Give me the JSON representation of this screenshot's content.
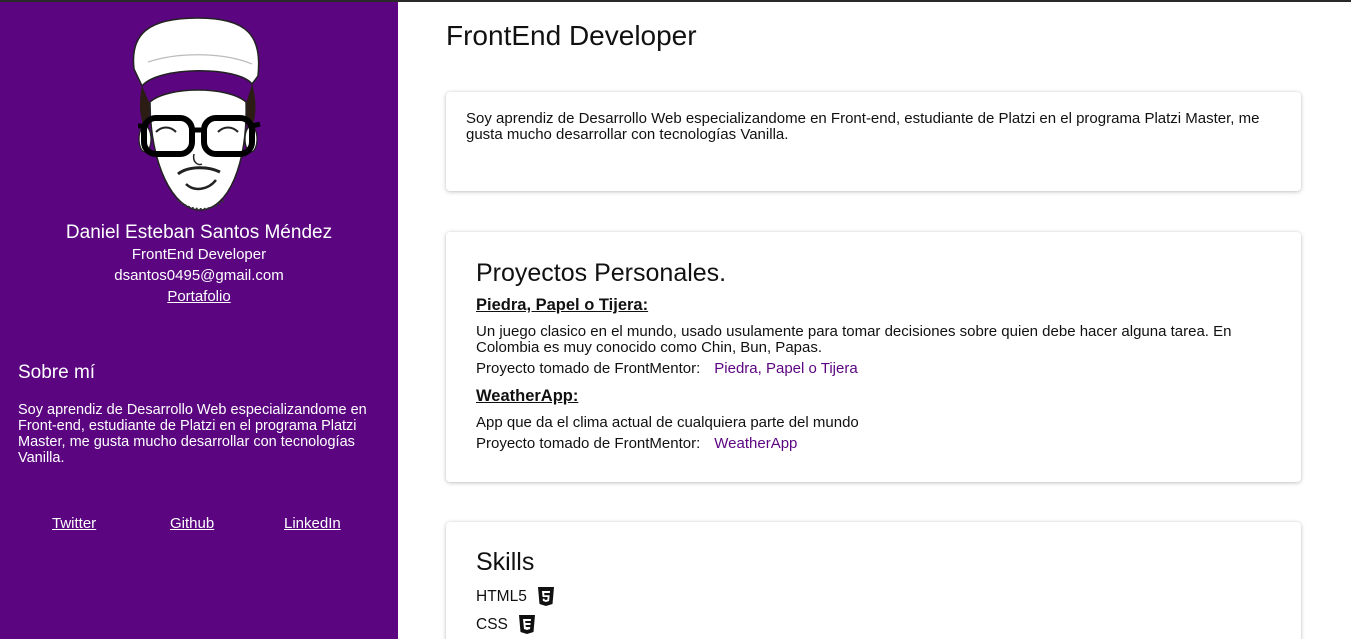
{
  "sidebar": {
    "name": "Daniel Esteban Santos Méndez",
    "role": "FrontEnd Developer",
    "email": "dsantos0495@gmail.com",
    "portfolio_label": "Portafolio",
    "about_title": "Sobre mí",
    "about_text": "Soy aprendiz de Desarrollo Web especializandome en Front-end, estudiante de Platzi en el programa Platzi Master, me gusta mucho desarrollar con tecnologías Vanilla.",
    "social": {
      "twitter": "Twitter",
      "github": "Github",
      "linkedin": "LinkedIn"
    }
  },
  "main": {
    "title": "FrontEnd Developer",
    "intro": "Soy aprendiz de Desarrollo Web especializandome en Front-end, estudiante de Platzi en el programa Platzi Master, me gusta mucho desarrollar con tecnologías Vanilla.",
    "projects": {
      "title": "Proyectos Personales.",
      "items": [
        {
          "name": "Piedra, Papel o Tijera:",
          "description": "Un juego clasico en el mundo, usado usulamente para tomar decisiones sobre quien debe hacer alguna tarea. En Colombia es muy conocido como Chin, Bun, Papas.",
          "source_label": "Proyecto tomado de FrontMentor:",
          "link_label": "Piedra, Papel o Tijera"
        },
        {
          "name": "WeatherApp:",
          "description": "App que da el clima actual de cualquiera parte del mundo",
          "source_label": "Proyecto tomado de FrontMentor:",
          "link_label": "WeatherApp"
        }
      ]
    },
    "skills": {
      "title": "Skills",
      "items": [
        {
          "label": "HTML5",
          "icon": "html5-icon"
        },
        {
          "label": "CSS",
          "icon": "css3-icon"
        }
      ]
    }
  },
  "colors": {
    "sidebar_bg": "#5b0581",
    "link": "#5b0581",
    "text": "#111111"
  }
}
